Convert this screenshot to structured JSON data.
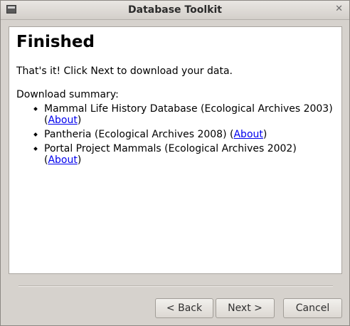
{
  "window": {
    "title": "Database Toolkit"
  },
  "page": {
    "heading": "Finished",
    "intro": "That's it! Click Next to download your data.",
    "summary_label": "Download summary:",
    "items": [
      {
        "name": "Mammal Life History Database (Ecological Archives 2003)",
        "link": "About"
      },
      {
        "name": "Pantheria (Ecological Archives 2008)",
        "link": "About"
      },
      {
        "name": "Portal Project Mammals (Ecological Archives 2002)",
        "link": "About"
      }
    ]
  },
  "buttons": {
    "back": "< Back",
    "next": "Next >",
    "cancel": "Cancel"
  },
  "colors": {
    "link": "#0000ee",
    "window_bg": "#d6d2cd",
    "content_bg": "#ffffff"
  }
}
